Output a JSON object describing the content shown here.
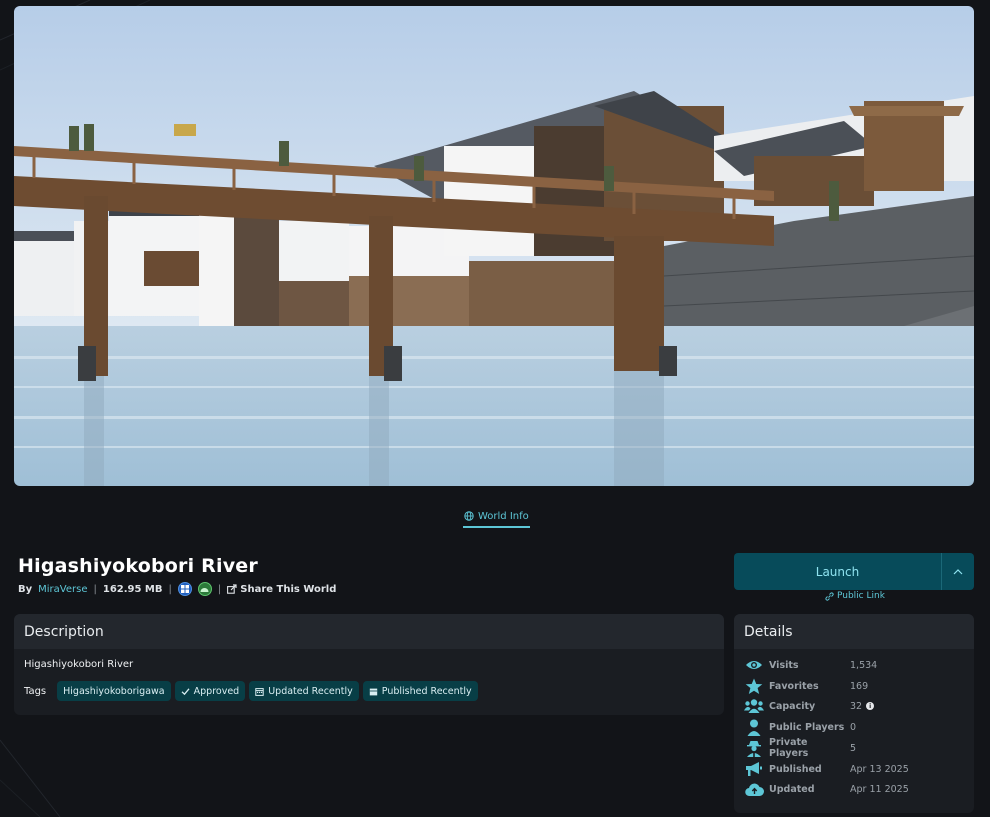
{
  "tabs": [
    {
      "label": "World Info"
    }
  ],
  "world": {
    "title": "Higashiyokobori River",
    "by_label": "By",
    "author": "MiraVerse",
    "size": "162.95 MB",
    "platforms": [
      "windows-icon",
      "android-icon"
    ],
    "share_label": "Share This World"
  },
  "launch": {
    "label": "Launch",
    "public_link": "Public Link"
  },
  "description": {
    "header": "Description",
    "text": "Higashiyokobori River",
    "tags_label": "Tags",
    "tags": [
      {
        "label": "Higashiyokoborigawa",
        "icon": ""
      },
      {
        "label": "Approved",
        "icon": "check-icon"
      },
      {
        "label": "Updated Recently",
        "icon": "calendar-icon"
      },
      {
        "label": "Published Recently",
        "icon": "calendar-icon"
      }
    ]
  },
  "details": {
    "header": "Details",
    "rows": [
      {
        "label": "Visits",
        "value": "1,534",
        "icon": "eye-icon"
      },
      {
        "label": "Favorites",
        "value": "169",
        "icon": "star-icon"
      },
      {
        "label": "Capacity",
        "value": "32",
        "icon": "users-icon"
      },
      {
        "label": "Public Players",
        "value": "0",
        "icon": "user-icon"
      },
      {
        "label": "Private Players",
        "value": "5",
        "icon": "user-secret-icon"
      },
      {
        "label": "Published",
        "value": "Apr 13 2025",
        "icon": "bullhorn-icon"
      },
      {
        "label": "Updated",
        "value": "Apr 11 2025",
        "icon": "cloud-upload-icon"
      }
    ]
  },
  "colors": {
    "accent": "#5dc6d6",
    "launch_bg": "#074b5a",
    "panel_bg": "#1a1d22",
    "panel_header": "#23272d",
    "tag_bg": "#083e46",
    "page_bg": "#121418"
  }
}
